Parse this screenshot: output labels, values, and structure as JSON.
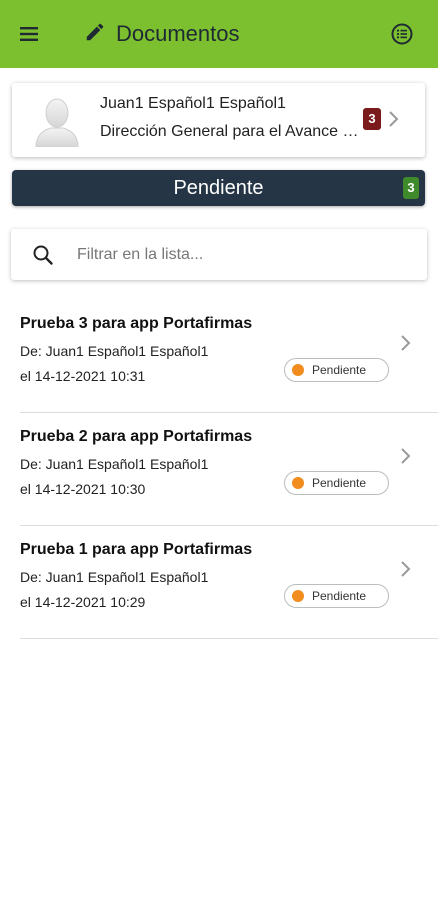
{
  "header": {
    "title": "Documentos",
    "menu_icon": "hamburger-menu-icon",
    "edit_icon": "pencil-icon",
    "list_icon": "list-circle-icon",
    "bar_color": "#7cbf2f"
  },
  "user": {
    "name": "Juan1 Español1 Español1",
    "organization": "Dirección General para el Avance de la Administración Digital",
    "badge_count": "3",
    "badge_color": "#7a1a1a"
  },
  "status": {
    "label": "Pendiente",
    "count": "3",
    "bar_color": "#253545",
    "count_color": "#3f8a2a"
  },
  "search": {
    "placeholder": "Filtrar en la lista..."
  },
  "documents": [
    {
      "title": "Prueba 3 para app Portafirmas",
      "from": "De: Juan1 Español1 Español1",
      "date": "el 14-12-2021 10:31",
      "status": "Pendiente"
    },
    {
      "title": "Prueba 2 para app Portafirmas",
      "from": "De: Juan1 Español1 Español1",
      "date": "el 14-12-2021 10:30",
      "status": "Pendiente"
    },
    {
      "title": "Prueba 1 para app Portafirmas",
      "from": "De: Juan1 Español1 Español1",
      "date": "el 14-12-2021 10:29",
      "status": "Pendiente"
    }
  ],
  "status_dot_color": "#f28c1e"
}
